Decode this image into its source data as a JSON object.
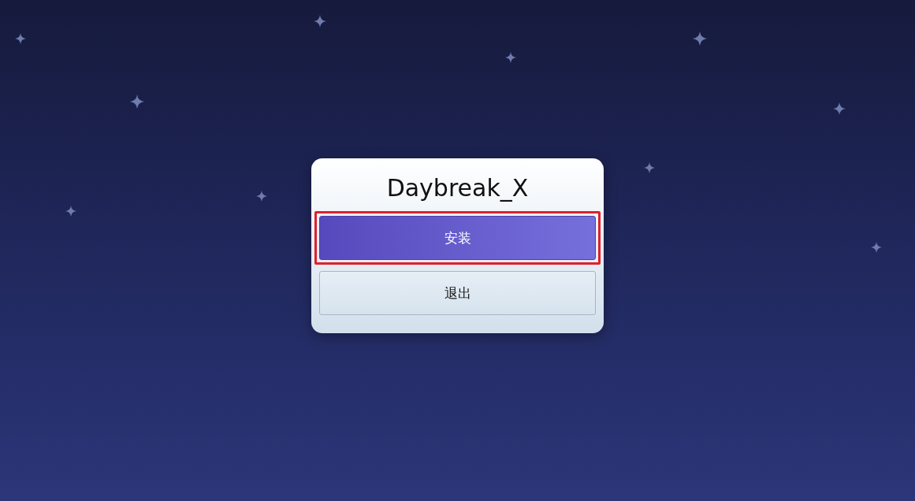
{
  "dialog": {
    "title": "Daybreak_X",
    "buttons": [
      {
        "label": "安装",
        "kind": "primary",
        "highlighted": true
      },
      {
        "label": "退出",
        "kind": "secondary",
        "highlighted": false
      }
    ]
  }
}
